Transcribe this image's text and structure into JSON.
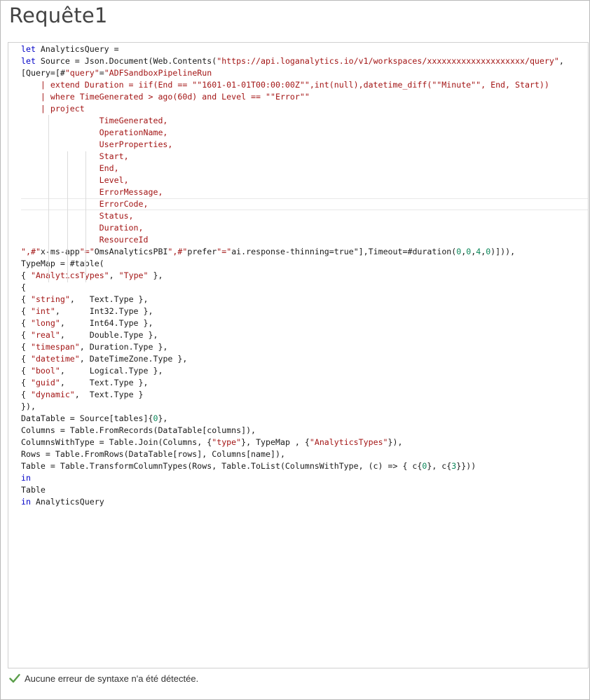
{
  "window": {
    "title": "Requête1"
  },
  "editor": {
    "lines": [
      "let AnalyticsQuery =",
      "let Source = Json.Document(Web.Contents(\"https://api.loganalytics.io/v1/workspaces/xxxxxxxxxxxxxxxxxxxx/query\",",
      "[Query=[#\"query\"=\"ADFSandboxPipelineRun",
      "    | extend Duration = iif(End == \"\"1601-01-01T00:00:00Z\"\",int(null),datetime_diff(\"\"Minute\"\", End, Start))",
      "    | where TimeGenerated > ago(60d) and Level == \"\"Error\"\"",
      "    | project",
      "                TimeGenerated,",
      "                OperationName,",
      "                UserProperties,",
      "                Start,",
      "                End,",
      "                Level,",
      "                ErrorMessage,",
      "                ErrorCode,",
      "                Status,",
      "                Duration,",
      "                ResourceId",
      "\",#\"x-ms-app\"=\"OmsAnalyticsPBI\",#\"prefer\"=\"ai.response-thinning=true\"],Timeout=#duration(0,0,4,0)])),",
      "TypeMap = #table(",
      "{ \"AnalyticsTypes\", \"Type\" },",
      "{",
      "{ \"string\",   Text.Type },",
      "{ \"int\",      Int32.Type },",
      "{ \"long\",     Int64.Type },",
      "{ \"real\",     Double.Type },",
      "{ \"timespan\", Duration.Type },",
      "{ \"datetime\", DateTimeZone.Type },",
      "{ \"bool\",     Logical.Type },",
      "{ \"guid\",     Text.Type },",
      "{ \"dynamic\",  Text.Type }",
      "}),",
      "DataTable = Source[tables]{0},",
      "Columns = Table.FromRecords(DataTable[columns]),",
      "ColumnsWithType = Table.Join(Columns, {\"type\"}, TypeMap , {\"AnalyticsTypes\"}),",
      "Rows = Table.FromRows(DataTable[rows], Columns[name]),",
      "Table = Table.TransformColumnTypes(Rows, Table.ToList(ColumnsWithType, (c) => { c{0}, c{3}}))",
      "in",
      "Table",
      "in AnalyticsQuery"
    ],
    "current_line": 14
  },
  "status": {
    "icon": "checkmark-icon",
    "text": "Aucune erreur de syntaxe n'a été détectée.",
    "color": "#5a9e4a"
  },
  "colors": {
    "keyword": "#0000c8",
    "string": "#a31515",
    "number": "#098658"
  }
}
